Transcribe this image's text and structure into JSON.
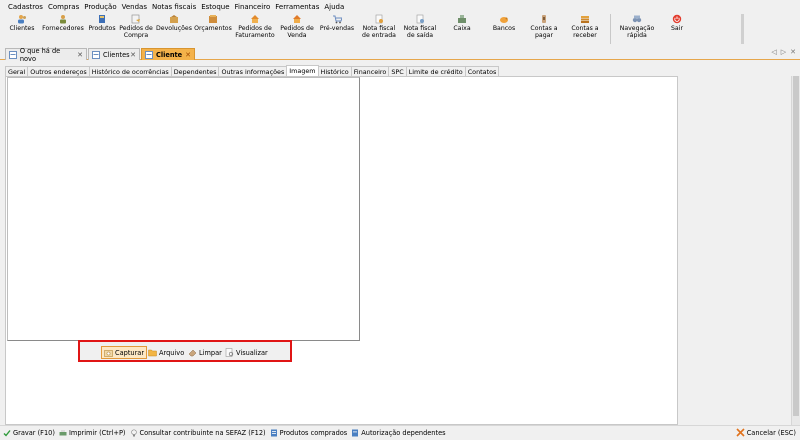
{
  "menu": [
    "Cadastros",
    "Compras",
    "Produção",
    "Vendas",
    "Notas fiscais",
    "Estoque",
    "Financeiro",
    "Ferramentas",
    "Ajuda"
  ],
  "toolbar": [
    {
      "label": "Clientes",
      "icon": "users-icon"
    },
    {
      "label": "Fornecedores",
      "icon": "supplier-icon"
    },
    {
      "label": "Produtos",
      "icon": "products-icon"
    },
    {
      "label": "Pedidos de\nCompra",
      "icon": "purchase-order-icon"
    },
    {
      "label": "Devoluções",
      "icon": "returns-icon"
    },
    {
      "label": "Orçamentos",
      "icon": "quotes-icon"
    },
    {
      "label": "Pedidos de\nFaturamento",
      "icon": "billing-order-icon"
    },
    {
      "label": "Pedidos de\nVenda",
      "icon": "sales-order-icon"
    },
    {
      "label": "Pré-vendas",
      "icon": "cart-icon"
    },
    {
      "label": "Nota fiscal\nde entrada",
      "icon": "invoice-in-icon"
    },
    {
      "label": "Nota fiscal\nde saída",
      "icon": "invoice-out-icon"
    },
    {
      "label": "Caixa",
      "icon": "cash-register-icon"
    },
    {
      "label": "Bancos",
      "icon": "bank-icon"
    },
    {
      "label": "Contas a\npagar",
      "icon": "payable-icon"
    },
    {
      "label": "Contas a\nreceber",
      "icon": "receivable-icon"
    },
    {
      "label": "Navegação\nrápida",
      "icon": "binoculars-icon"
    },
    {
      "label": "Sair",
      "icon": "power-icon"
    }
  ],
  "doc_tabs": [
    {
      "label": "O que há de novo",
      "active": false
    },
    {
      "label": "Clientes",
      "active": false
    },
    {
      "label": "Cliente",
      "active": true
    }
  ],
  "inner_tabs": [
    "Geral",
    "Outros endereços",
    "Histórico de ocorrências",
    "Dependentes",
    "Outras informações",
    "Imagem",
    "Histórico",
    "Financeiro",
    "SPC",
    "Limite de crédito",
    "Contatos"
  ],
  "inner_active": "Imagem",
  "capture_buttons": [
    {
      "label": "Capturar",
      "icon": "camera-icon"
    },
    {
      "label": "Arquivo",
      "icon": "folder-icon"
    },
    {
      "label": "Limpar",
      "icon": "eraser-icon"
    },
    {
      "label": "Visualizar",
      "icon": "preview-icon"
    }
  ],
  "status": [
    {
      "label": "Gravar (F10)",
      "icon": "check-icon"
    },
    {
      "label": "Imprimir (Ctrl+P)",
      "icon": "printer-icon"
    },
    {
      "label": "Consultar contribuinte na SEFAZ (F12)",
      "icon": "lightbulb-icon"
    },
    {
      "label": "Produtos comprados",
      "icon": "list-icon"
    },
    {
      "label": "Autorização dependentes",
      "icon": "authorize-icon"
    }
  ],
  "cancel_label": "Cancelar (ESC)",
  "colors": {
    "accent": "#f4b24a",
    "highlight": "#e01515"
  }
}
